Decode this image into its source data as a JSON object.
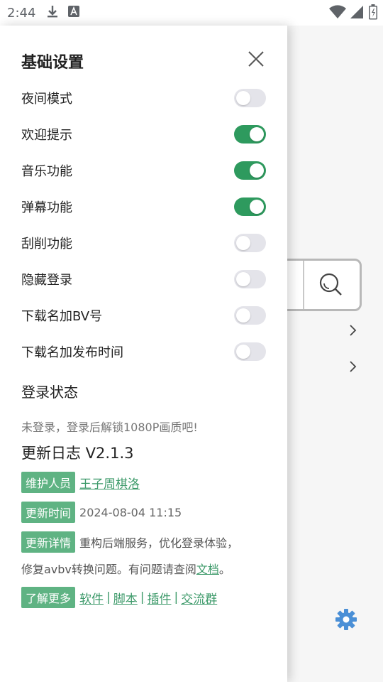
{
  "status_bar": {
    "time": "2:44",
    "icons": [
      "download-icon",
      "text-a-icon",
      "wifi-icon",
      "signal-icon",
      "battery-icon"
    ]
  },
  "drawer": {
    "title": "基础设置",
    "close_icon": "close-icon",
    "toggles": [
      {
        "label": "夜间模式",
        "on": false
      },
      {
        "label": "欢迎提示",
        "on": true
      },
      {
        "label": "音乐功能",
        "on": true
      },
      {
        "label": "弹幕功能",
        "on": true
      },
      {
        "label": "刮削功能",
        "on": false
      },
      {
        "label": "隐藏登录",
        "on": false
      },
      {
        "label": "下载名加BV号",
        "on": false
      },
      {
        "label": "下载名加发布时间",
        "on": false
      }
    ],
    "login": {
      "heading": "登录状态",
      "note": "未登录，登录后解锁1080P画质吧!"
    },
    "changelog": {
      "heading": "更新日志 V2.1.3",
      "maintainer_badge": "维护人员",
      "maintainer_name": "王子周棋洛",
      "time_badge": "更新时间",
      "time_value": "2024-08-04 11:15",
      "details_badge": "更新详情",
      "details_line1": "重构后端服务，优化登录体验，",
      "details_line2_prefix": "修复avbv转换问题。有问题请查阅",
      "details_link": "文档",
      "details_suffix": "。",
      "more_badge": "了解更多",
      "more_links": [
        "软件",
        "脚本",
        "插件",
        "交流群"
      ],
      "separator": "|"
    }
  },
  "background": {
    "search_icon": "search-icon",
    "chevron_icon": "chevron-right-icon",
    "settings_icon": "gear-icon"
  },
  "colors": {
    "accent": "#2e9a5e",
    "badge": "#5fb383",
    "link": "#3d9a6a",
    "gear": "#4a8fd6"
  }
}
